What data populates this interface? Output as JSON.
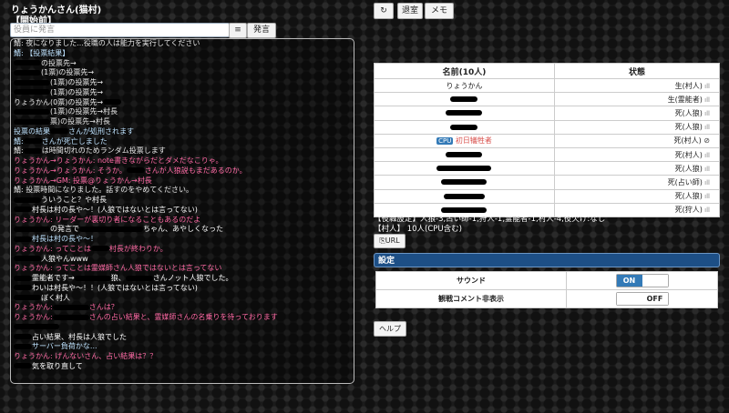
{
  "header": {
    "title": "りょうかんさん(猫村)",
    "state": "【開始前】"
  },
  "chat": {
    "placeholder": "役員に発言",
    "menu_icon": "≡",
    "say_label": "発言"
  },
  "log": [
    {
      "cls": "c-gm",
      "pre": "鯖: 夜になりました...役職の人は能力を実行してください",
      "r": 0,
      "post": ""
    },
    {
      "cls": "c-sys",
      "pre": "鯖: 【投票結果】",
      "r": 0,
      "post": ""
    },
    {
      "cls": "c-gm",
      "pre": "",
      "r": 30,
      "post": "の投票先→"
    },
    {
      "cls": "c-gm",
      "pre": "",
      "r": 30,
      "post": "(1票)の投票先→"
    },
    {
      "cls": "c-gm",
      "pre": "",
      "r": 40,
      "post": "(1票)の投票先→"
    },
    {
      "cls": "c-gm",
      "pre": "",
      "r": 40,
      "post": "(1票)の投票先→"
    },
    {
      "cls": "c-gm",
      "pre": "りょうかん(0票)の投票先→",
      "r": 20,
      "post": ""
    },
    {
      "cls": "c-gm",
      "pre": "",
      "r": 40,
      "post": "(1票)の投票先→村長"
    },
    {
      "cls": "c-gm",
      "pre": "",
      "r": 40,
      "post": "票)の投票先→村長"
    },
    {
      "cls": "c-sys",
      "pre": "投票の結果",
      "r": 20,
      "post": "さんが処刑されます"
    },
    {
      "cls": "c-sys",
      "pre": "鯖:",
      "r": 20,
      "post": "さんが死亡しました"
    },
    {
      "cls": "c-gm",
      "pre": "鯖:",
      "r": 20,
      "post": "は時間切れのためランダム投票します"
    },
    {
      "cls": "c-pink",
      "pre": "りょうかん→りょうかん: note書きながらだとダメだなこりゃ。",
      "r": 0,
      "post": ""
    },
    {
      "cls": "c-pink",
      "pre": "りょうかん→りょうかん: そうか。",
      "r": 20,
      "post": "さんが人狼説もまだあるのか。"
    },
    {
      "cls": "c-pink",
      "pre": "りょうかん→GM: 投票@りょうかん→村長",
      "r": 0,
      "post": ""
    },
    {
      "cls": "c-gm",
      "pre": "鯖: 投票時間になりました。話すのをやめてください。",
      "r": 0,
      "post": ""
    },
    {
      "cls": "c-say",
      "pre": "",
      "r": 30,
      "post": "ういうこと？や村長"
    },
    {
      "cls": "c-say",
      "pre": "",
      "r": 20,
      "post": "村長は村の長や～！(人狼ではないとは言ってない)"
    },
    {
      "cls": "c-pink",
      "pre": "りょうかん: リーダーが裏切り者になることもあるのだよ",
      "r": 0,
      "post": ""
    },
    {
      "cls": "c-say",
      "pre": "",
      "r": 40,
      "post": "の発言で",
      "r2": 70,
      "post2": "ちゃん、あやしくなった"
    },
    {
      "cls": "c-sys",
      "pre": "",
      "r": 20,
      "post": "村長は村の長や～！"
    },
    {
      "cls": "c-pink",
      "pre": "りょうかん: ってことは",
      "r": 20,
      "post": "村長が終わりか。"
    },
    {
      "cls": "c-say",
      "pre": "",
      "r": 30,
      "post": "人狼やんwww"
    },
    {
      "cls": "c-pink",
      "pre": "りょうかん: ってことは霊媒師さん人狼ではないとは言ってない",
      "r": 0,
      "post": ""
    },
    {
      "cls": "c-say",
      "pre": "",
      "r": 20,
      "post": "霊能者です→",
      "r2": 40,
      "post2": "狼、",
      "r3": 30,
      "post3": "さんノット人狼でした。"
    },
    {
      "cls": "c-say",
      "pre": "",
      "r": 20,
      "post": "わいは村長や～！！(人狼ではないとは言ってない)"
    },
    {
      "cls": "c-say",
      "pre": "",
      "r": 30,
      "post": "ぼく村人"
    },
    {
      "cls": "c-pink",
      "pre": "りょうかん:",
      "r": 40,
      "post": "さんは？"
    },
    {
      "cls": "c-pink",
      "pre": "りょうかん:",
      "r": 40,
      "post": "さんの占い結果と、霊媒師さんの名乗りを待っております"
    },
    {
      "cls": "c-say",
      "pre": "",
      "r": 50,
      "post": ""
    },
    {
      "cls": "c-say",
      "pre": "",
      "r": 20,
      "post": "占い結果、村長は人狼でした"
    },
    {
      "cls": "c-sys",
      "pre": "",
      "r": 20,
      "post": "サーバー負荷かな..."
    },
    {
      "cls": "c-pink",
      "pre": "りょうかん: げんないさん、占い結果は？？",
      "r": 0,
      "post": ""
    },
    {
      "cls": "c-say",
      "pre": "",
      "r": 20,
      "post": "気を取り直して"
    }
  ],
  "top_buttons": {
    "refresh_icon": "↻",
    "leave": "退室",
    "memo": "メモ"
  },
  "players": {
    "headers": [
      "名前(10人)",
      "状態"
    ],
    "rows": [
      {
        "name": "りょうかん",
        "status": "生(村人)",
        "icon": "signal",
        "redact": 0,
        "cpu": false
      },
      {
        "name": "",
        "status": "生(霊能者)",
        "icon": "signal",
        "redact": 30,
        "cpu": false
      },
      {
        "name": "",
        "status": "死(人狼)",
        "icon": "signal",
        "redact": 40,
        "cpu": false
      },
      {
        "name": "",
        "status": "死(人狼)",
        "icon": "signal",
        "redact": 30,
        "cpu": false
      },
      {
        "name": "初日犠牲者",
        "status": "死(村人)",
        "icon": "none",
        "redact": 0,
        "cpu": true,
        "cpu_label": "CPU"
      },
      {
        "name": "",
        "status": "死(村人)",
        "icon": "signal",
        "redact": 40,
        "cpu": false
      },
      {
        "name": "",
        "status": "死(人狼)",
        "icon": "signal",
        "redact": 60,
        "cpu": false
      },
      {
        "name": "",
        "status": "死(占い師)",
        "icon": "signal",
        "redact": 50,
        "cpu": false
      },
      {
        "name": "",
        "status": "死(人狼)",
        "icon": "signal",
        "redact": 45,
        "cpu": false
      },
      {
        "name": "",
        "status": "死(狩人)",
        "icon": "signal",
        "redact": 50,
        "cpu": false
      }
    ]
  },
  "info": {
    "roles": "【役職設定】人狼-3,占い師-1,狩人-1,霊能者-1,村人-4,役欠け:なし",
    "village": "【村人】 10人(CPU含む)",
    "url_label": "URL"
  },
  "settings": {
    "title": "設定",
    "sound_label": "サウンド",
    "sound_state": "ON",
    "spectator_label": "観戦コメント非表示",
    "spectator_state": "OFF"
  },
  "help_label": "ヘルプ"
}
